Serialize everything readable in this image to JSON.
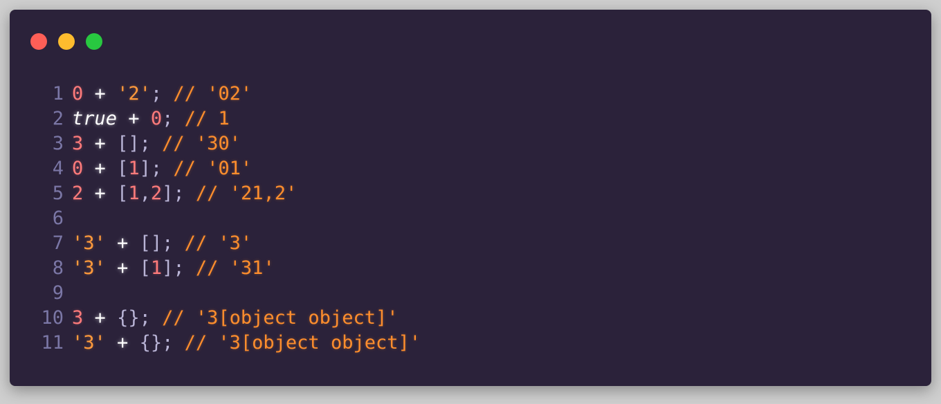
{
  "window": {
    "controls": [
      {
        "name": "close",
        "color": "#fe5f57"
      },
      {
        "name": "minimize",
        "color": "#febc2e"
      },
      {
        "name": "maximize",
        "color": "#28c840"
      }
    ]
  },
  "colors": {
    "background": "#2b223a",
    "line_number": "#7b77a6",
    "number": "#ff7b7b",
    "string": "#ff9a3c",
    "comment": "#ff8e2d",
    "operator": "#ffffff",
    "punctuation": "#b9b4d6",
    "keyword": "#ffffff"
  },
  "lines": [
    {
      "num": "1",
      "tokens": [
        {
          "t": "0",
          "k": "number"
        },
        {
          "t": " ",
          "k": "space"
        },
        {
          "t": "+",
          "k": "operator"
        },
        {
          "t": " ",
          "k": "space"
        },
        {
          "t": "'2'",
          "k": "string"
        },
        {
          "t": ";",
          "k": "punctuation"
        },
        {
          "t": " ",
          "k": "space"
        },
        {
          "t": "// '02'",
          "k": "comment"
        }
      ]
    },
    {
      "num": "2",
      "tokens": [
        {
          "t": "true",
          "k": "keyword"
        },
        {
          "t": " ",
          "k": "space"
        },
        {
          "t": "+",
          "k": "operator"
        },
        {
          "t": " ",
          "k": "space"
        },
        {
          "t": "0",
          "k": "number"
        },
        {
          "t": ";",
          "k": "punctuation"
        },
        {
          "t": " ",
          "k": "space"
        },
        {
          "t": "// 1",
          "k": "comment"
        }
      ]
    },
    {
      "num": "3",
      "tokens": [
        {
          "t": "3",
          "k": "number"
        },
        {
          "t": " ",
          "k": "space"
        },
        {
          "t": "+",
          "k": "operator"
        },
        {
          "t": " ",
          "k": "space"
        },
        {
          "t": "[]",
          "k": "punctuation"
        },
        {
          "t": ";",
          "k": "punctuation"
        },
        {
          "t": " ",
          "k": "space"
        },
        {
          "t": "// '30'",
          "k": "comment"
        }
      ]
    },
    {
      "num": "4",
      "tokens": [
        {
          "t": "0",
          "k": "number"
        },
        {
          "t": " ",
          "k": "space"
        },
        {
          "t": "+",
          "k": "operator"
        },
        {
          "t": " ",
          "k": "space"
        },
        {
          "t": "[",
          "k": "punctuation"
        },
        {
          "t": "1",
          "k": "number"
        },
        {
          "t": "]",
          "k": "punctuation"
        },
        {
          "t": ";",
          "k": "punctuation"
        },
        {
          "t": " ",
          "k": "space"
        },
        {
          "t": "// '01'",
          "k": "comment"
        }
      ]
    },
    {
      "num": "5",
      "tokens": [
        {
          "t": "2",
          "k": "number"
        },
        {
          "t": " ",
          "k": "space"
        },
        {
          "t": "+",
          "k": "operator"
        },
        {
          "t": " ",
          "k": "space"
        },
        {
          "t": "[",
          "k": "punctuation"
        },
        {
          "t": "1",
          "k": "number"
        },
        {
          "t": ",",
          "k": "punctuation"
        },
        {
          "t": "2",
          "k": "number"
        },
        {
          "t": "]",
          "k": "punctuation"
        },
        {
          "t": ";",
          "k": "punctuation"
        },
        {
          "t": " ",
          "k": "space"
        },
        {
          "t": "// '21,2'",
          "k": "comment"
        }
      ]
    },
    {
      "num": "6",
      "tokens": []
    },
    {
      "num": "7",
      "tokens": [
        {
          "t": "'3'",
          "k": "string"
        },
        {
          "t": " ",
          "k": "space"
        },
        {
          "t": "+",
          "k": "operator"
        },
        {
          "t": " ",
          "k": "space"
        },
        {
          "t": "[]",
          "k": "punctuation"
        },
        {
          "t": ";",
          "k": "punctuation"
        },
        {
          "t": " ",
          "k": "space"
        },
        {
          "t": "// '3'",
          "k": "comment"
        }
      ]
    },
    {
      "num": "8",
      "tokens": [
        {
          "t": "'3'",
          "k": "string"
        },
        {
          "t": " ",
          "k": "space"
        },
        {
          "t": "+",
          "k": "operator"
        },
        {
          "t": " ",
          "k": "space"
        },
        {
          "t": "[",
          "k": "punctuation"
        },
        {
          "t": "1",
          "k": "number"
        },
        {
          "t": "]",
          "k": "punctuation"
        },
        {
          "t": ";",
          "k": "punctuation"
        },
        {
          "t": " ",
          "k": "space"
        },
        {
          "t": "// '31'",
          "k": "comment"
        }
      ]
    },
    {
      "num": "9",
      "tokens": []
    },
    {
      "num": "10",
      "tokens": [
        {
          "t": "3",
          "k": "number"
        },
        {
          "t": " ",
          "k": "space"
        },
        {
          "t": "+",
          "k": "operator"
        },
        {
          "t": " ",
          "k": "space"
        },
        {
          "t": "{}",
          "k": "punctuation"
        },
        {
          "t": ";",
          "k": "punctuation"
        },
        {
          "t": " ",
          "k": "space"
        },
        {
          "t": "// '3[object object]'",
          "k": "comment"
        }
      ]
    },
    {
      "num": "11",
      "tokens": [
        {
          "t": "'3'",
          "k": "string"
        },
        {
          "t": " ",
          "k": "space"
        },
        {
          "t": "+",
          "k": "operator"
        },
        {
          "t": " ",
          "k": "space"
        },
        {
          "t": "{}",
          "k": "punctuation"
        },
        {
          "t": ";",
          "k": "punctuation"
        },
        {
          "t": " ",
          "k": "space"
        },
        {
          "t": "// '3[object object]'",
          "k": "comment"
        }
      ]
    }
  ]
}
